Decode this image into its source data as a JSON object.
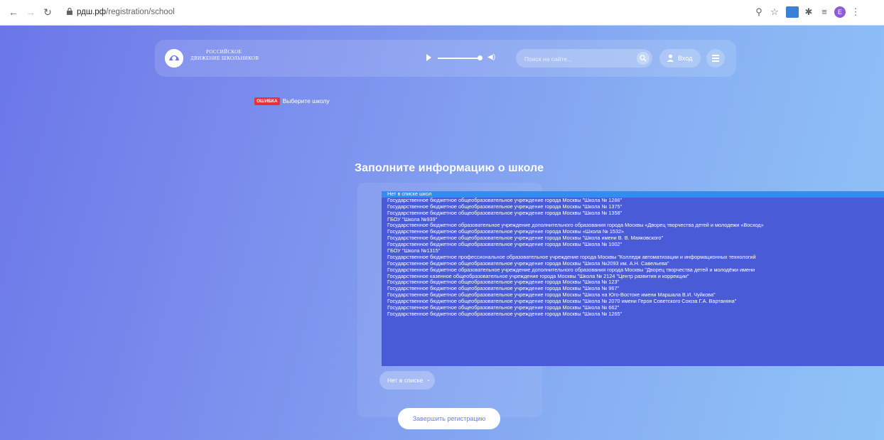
{
  "browser": {
    "url_host": "рдш.рф",
    "url_path": "/registration/school",
    "back_icon": "back-arrow-icon",
    "forward_icon": "forward-arrow-icon",
    "reload_icon": "reload-icon"
  },
  "header": {
    "logo_line1": "РОССИЙСКОЕ",
    "logo_line2": "ДВИЖЕНИЕ ШКОЛЬНИКОВ",
    "search_placeholder": "Поиск на сайте...",
    "login_label": "Вход"
  },
  "error": {
    "badge": "ОШИБКА",
    "message": "Выберите школу"
  },
  "form": {
    "title": "Заполните информацию о школе",
    "options": [
      "Нет в списке школ",
      "Государственное бюджетное общеобразовательное учреждение города Москвы \"Школа № 1286\"",
      "Государственное бюджетное общеобразовательное учреждение города Москвы \"Школа № 1375\"",
      "Государственное бюджетное общеобразовательное учреждение города Москвы \"Школа № 1358\"",
      "ГБОУ \"Школа №939\"",
      "Государственное бюджетное образовательное учреждение дополнительного образования города Москвы «Дворец творчества детей и молодежи «Восход»",
      "Государственное бюджетное общеобразовательное учреждение города Москвы «Школа № 1532»",
      "Государственное бюджетное общеобразовательное учреждение города Москвы \"Школа имени В. В. Маяковского\"",
      "Государственное бюджетное общеобразовательное учреждение города Москвы \"Школа № 1002\"",
      "ГБОУ \"Школа №1315\"",
      "Государственное бюджетное профессиональное образовательное учреждение города Москвы \"Колледж автоматизации и информационных технологий",
      "Государственное бюджетное общеобразовательное учреждение города Москвы \"Школа №2093 им. А.Н. Савельева\"",
      "Государственное бюджетное образовательное учреждение дополнительного образования города Москвы \"Дворец творчества детей и молодёжи имени",
      "Государственное казенное общеобразовательное учреждение города Москвы \"Школа № 2124 \"Центр развития и коррекции\"",
      "Государственное бюджетное общеобразовательное учреждение города Москвы \"Школа № 123\"",
      "Государственное бюджетное общеобразовательное учреждение города Москвы \"Школа № 967\"",
      "Государственное бюджетное общеобразовательное учреждение города Москвы \"Школа на Юго-Востоке имени Маршала В.И. Чуйкова\"",
      "Государственное бюджетное общеобразовательное учреждение города Москвы \"Школа № 2070 имени Героя Советского Союза Г.А. Вартаняна\"",
      "Государственное бюджетное общеобразовательное учреждение города Москвы \"Школа № 662\"",
      "Государственное бюджетное общеобразовательное учреждение города Москвы \"Школа № 1265\""
    ],
    "select_value": "Нет в списке",
    "submit_label": "Завершить регистрацию"
  },
  "colors": {
    "accent": "#6b77e8",
    "selected_option": "#2f8ef2",
    "error": "#e53238"
  }
}
